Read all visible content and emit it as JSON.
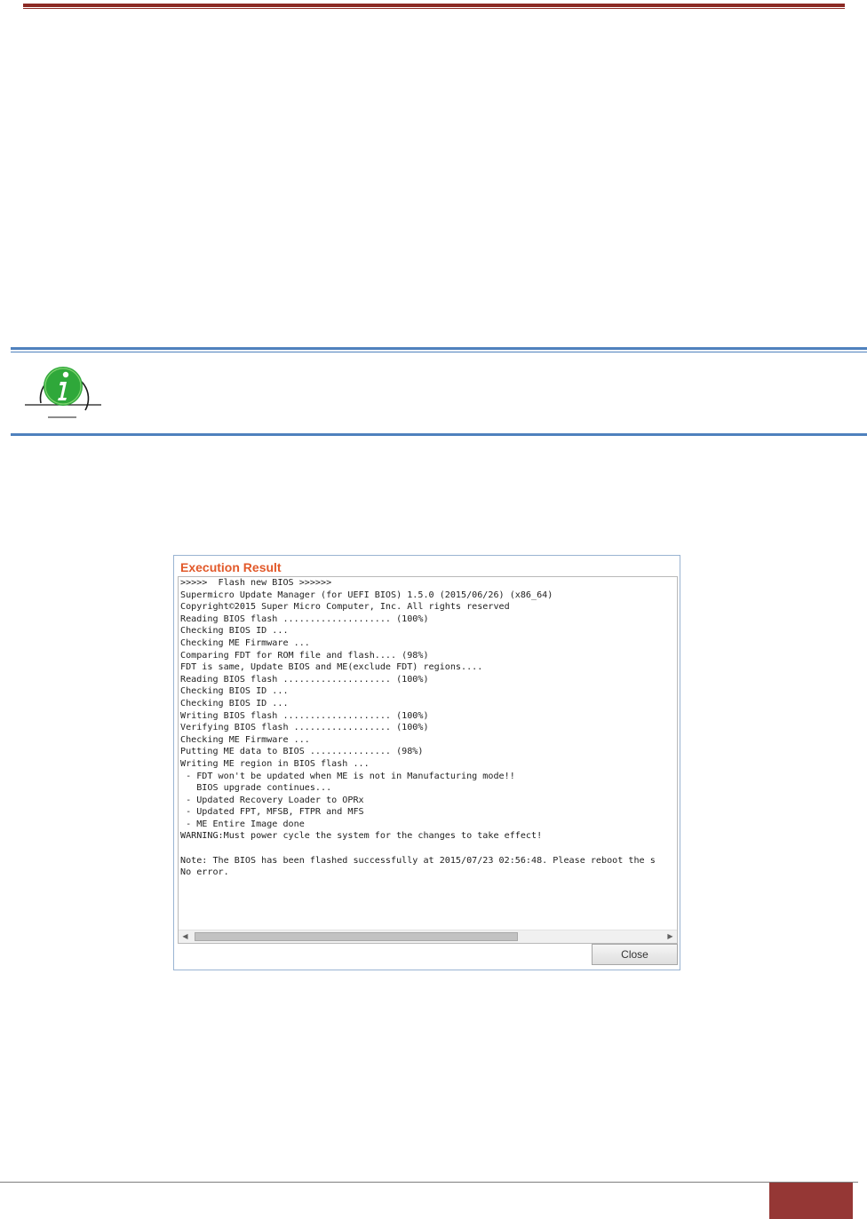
{
  "colors": {
    "header_rule": "#8b2a24",
    "note_rule": "#4f81bd",
    "dialog_title": "#e2592a",
    "page_tab": "#953735"
  },
  "note": {
    "icon": "info-icon"
  },
  "dialog": {
    "title": "Execution Result",
    "output_lines": [
      ">>>>>  Flash new BIOS >>>>>>",
      "Supermicro Update Manager (for UEFI BIOS) 1.5.0 (2015/06/26) (x86_64)",
      "Copyright©2015 Super Micro Computer, Inc. All rights reserved",
      "Reading BIOS flash .................... (100%)",
      "Checking BIOS ID ...",
      "Checking ME Firmware ...",
      "Comparing FDT for ROM file and flash.... (98%)",
      "FDT is same, Update BIOS and ME(exclude FDT) regions....",
      "Reading BIOS flash .................... (100%)",
      "Checking BIOS ID ...",
      "Checking BIOS ID ...",
      "Writing BIOS flash .................... (100%)",
      "Verifying BIOS flash .................. (100%)",
      "Checking ME Firmware ...",
      "Putting ME data to BIOS ............... (98%)",
      "Writing ME region in BIOS flash ...",
      " - FDT won't be updated when ME is not in Manufacturing mode!!",
      "   BIOS upgrade continues...",
      " - Updated Recovery Loader to OPRx",
      " - Updated FPT, MFSB, FTPR and MFS",
      " - ME Entire Image done",
      "WARNING:Must power cycle the system for the changes to take effect!",
      "",
      "Note: The BIOS has been flashed successfully at 2015/07/23 02:56:48. Please reboot the s",
      "No error."
    ],
    "scroll_left_icon": "chevron-left-icon",
    "scroll_right_icon": "chevron-right-icon",
    "scroll_left_glyph": "◀",
    "scroll_right_glyph": "▶",
    "close_label": "Close"
  }
}
